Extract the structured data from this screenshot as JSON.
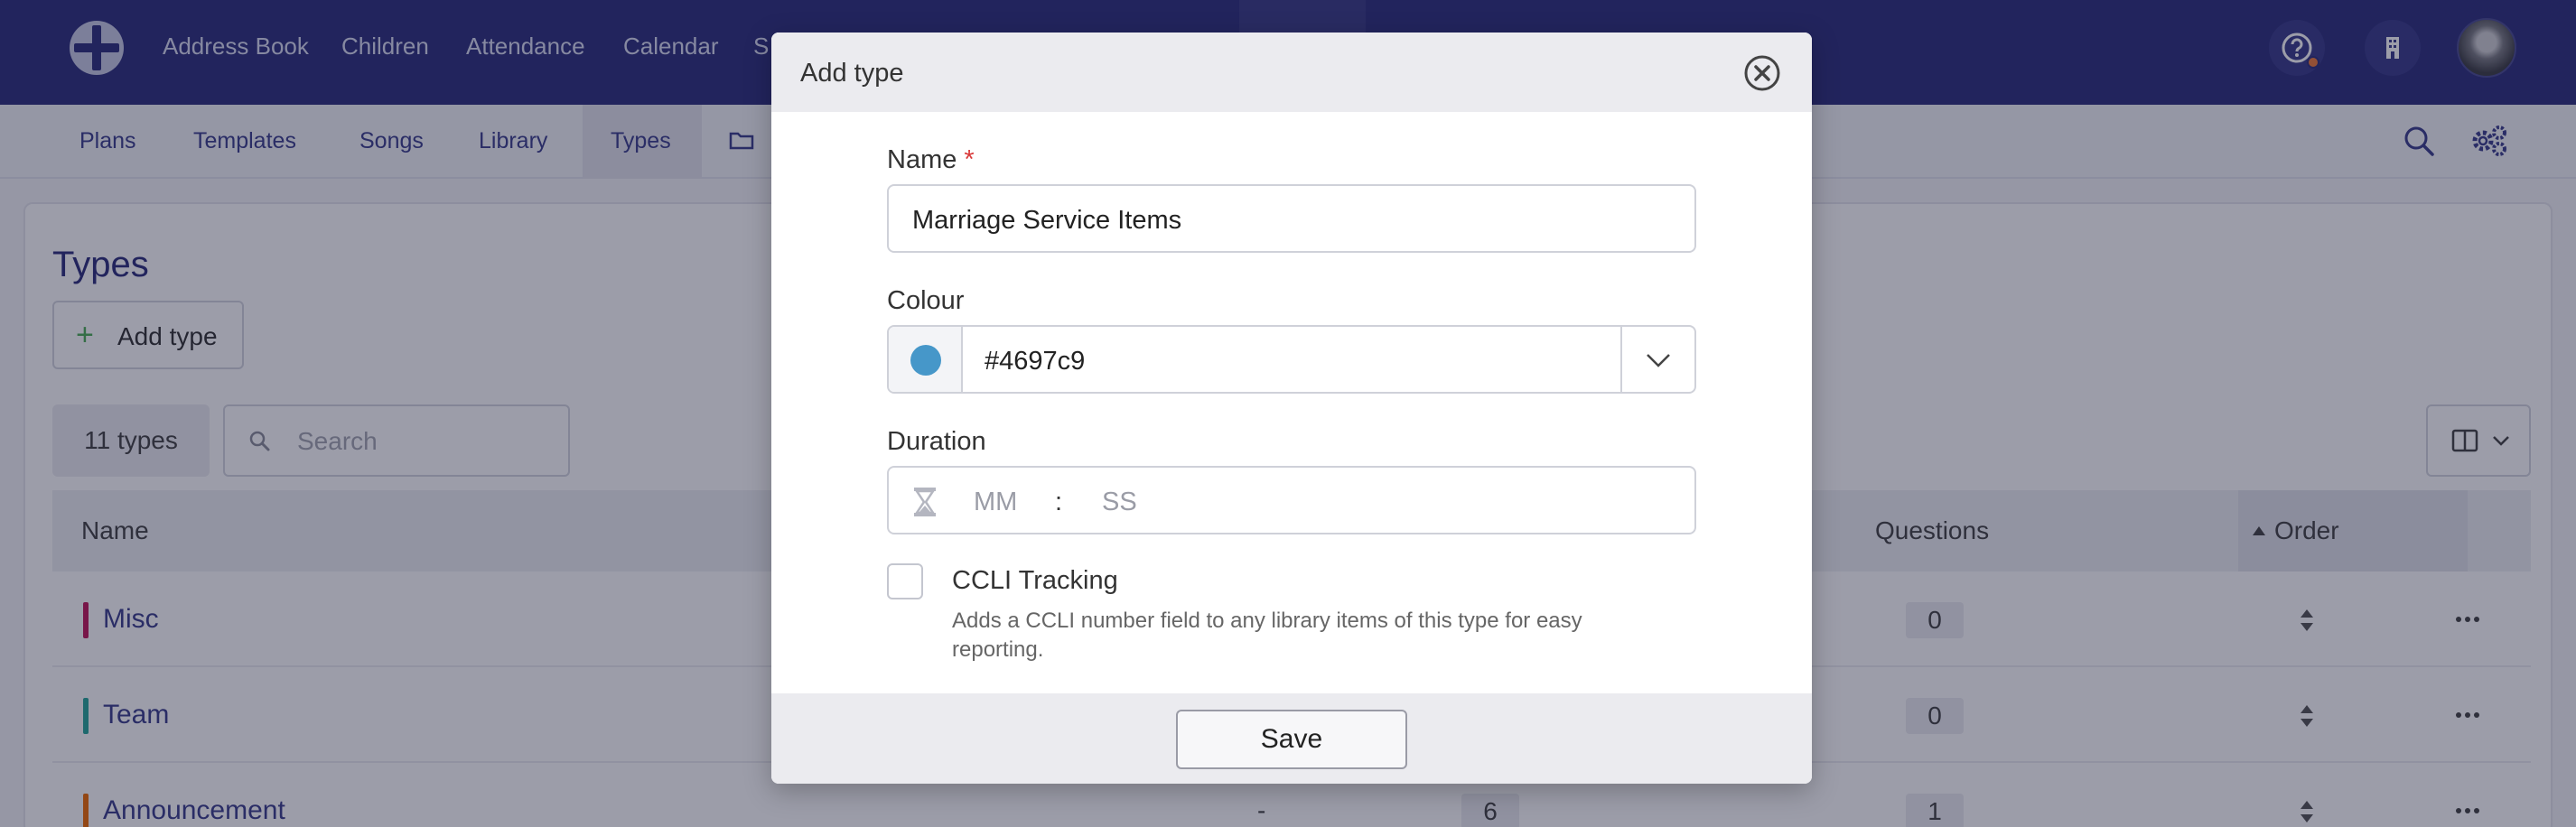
{
  "topnav": {
    "items": [
      "Address Book",
      "Children",
      "Attendance",
      "Calendar",
      "S"
    ]
  },
  "subnav": {
    "items": [
      "Plans",
      "Templates",
      "Songs",
      "Library",
      "Types"
    ]
  },
  "page": {
    "title": "Types",
    "add_button": "Add type",
    "count": "11 types",
    "search_placeholder": "Search",
    "columns": {
      "name": "Name",
      "questions": "Questions",
      "order": "Order"
    },
    "rows": [
      {
        "name": "Misc",
        "color": "#c2185b",
        "questions": "0"
      },
      {
        "name": "Team",
        "color": "#26a69a",
        "questions": "0"
      },
      {
        "name": "Announcement",
        "color": "#ef6c00",
        "dash": "-",
        "count": "6",
        "questions": "1"
      }
    ]
  },
  "modal": {
    "title": "Add type",
    "name_label": "Name",
    "required_mark": "*",
    "name_value": "Marriage Service Items",
    "colour_label": "Colour",
    "colour_value": "#4697c9",
    "duration_label": "Duration",
    "duration_mm_placeholder": "MM",
    "duration_separator": ":",
    "duration_ss_placeholder": "SS",
    "ccli_label": "CCLI Tracking",
    "ccli_description": "Adds a CCLI number field to any library items of this type for easy reporting.",
    "save_label": "Save"
  }
}
